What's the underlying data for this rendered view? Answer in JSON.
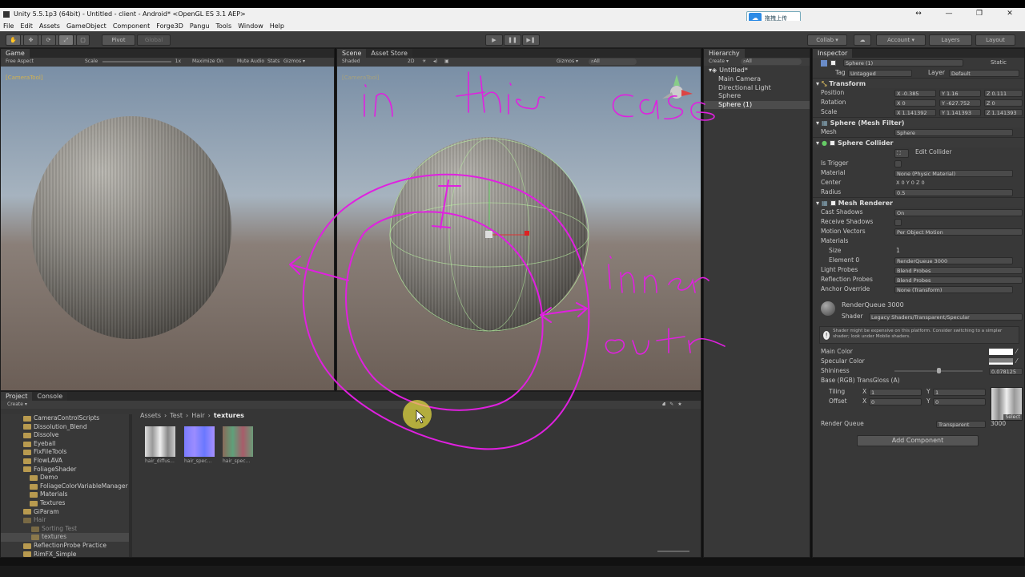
{
  "window": {
    "title": "Unity 5.5.1p3 (64bit) - Untitled - client - Android* <OpenGL ES 3.1 AEP>",
    "controls": [
      "↔",
      "—",
      "❐",
      "✕"
    ],
    "cloud_label": "拖拽上传"
  },
  "menu": [
    "File",
    "Edit",
    "Assets",
    "GameObject",
    "Component",
    "Forge3D",
    "Pangu",
    "Tools",
    "Window",
    "Help"
  ],
  "toolbar": {
    "pivot": "Pivot",
    "global": "Global",
    "collab": "Collab ▾",
    "account": "Account ▾",
    "layers": "Layers",
    "layout": "Layout"
  },
  "game": {
    "tab": "Game",
    "aspect": "Free Aspect",
    "scale_label": "Scale",
    "scale_value": "1x",
    "opts": [
      "Maximize On Play",
      "Mute Audio",
      "Stats",
      "Gizmos ▾"
    ],
    "overlay": "[CameraTool]"
  },
  "scene": {
    "tab": "Scene",
    "tab2": "Asset Store",
    "shaded": "Shaded",
    "mode2d": "2D",
    "gizmos": "Gizmos ▾",
    "search": "⌕All",
    "overlay": "[CameraTool]"
  },
  "hierarchy": {
    "tab": "Hierarchy",
    "create": "Create ▾",
    "search": "⌕All",
    "scene_name": "Untitled*",
    "items": [
      "Main Camera",
      "Directional Light",
      "Sphere",
      "Sphere (1)"
    ]
  },
  "project": {
    "tab": "Project",
    "tab2": "Console",
    "create": "Create ▾",
    "tree": [
      "CameraControlScripts",
      "Dissolution_Blend",
      "Dissolve",
      "Eyeball",
      "FixFileTools",
      "FlowLAVA",
      "FoliageShader",
      "Demo",
      "FoliageColorVariableManager",
      "Materials",
      "Textures",
      "GiParam",
      "Hair",
      "Sorting Test",
      "textures",
      "ReflectionProbe Practice",
      "RimFX_Simple"
    ],
    "breadcrumb": [
      "Assets",
      "Test",
      "Hair",
      "textures"
    ],
    "assets": [
      {
        "name": "hair_diffus...",
        "kind": "diffuse"
      },
      {
        "name": "hair_spec...",
        "kind": "normal"
      },
      {
        "name": "hair_spec...",
        "kind": "spec"
      }
    ]
  },
  "inspector": {
    "tab": "Inspector",
    "object_name": "Sphere (1)",
    "static": "Static",
    "tag_label": "Tag",
    "tag": "Untagged",
    "layer_label": "Layer",
    "layer": "Default",
    "transform": {
      "title": "Transform",
      "position": [
        "-0.385",
        "1.16",
        "0.111"
      ],
      "rotation": [
        "0",
        "-627.752",
        "0"
      ],
      "scale": [
        "1.141392",
        "1.141393",
        "1.141393"
      ],
      "labels": [
        "Position",
        "Rotation",
        "Scale"
      ]
    },
    "mesh_filter": {
      "title": "Sphere (Mesh Filter)",
      "mesh_label": "Mesh",
      "mesh": "Sphere"
    },
    "collider": {
      "title": "Sphere Collider",
      "edit": "Edit Collider",
      "rows": [
        {
          "label": "Is Trigger",
          "value": ""
        },
        {
          "label": "Material",
          "value": "None (Physic Material)"
        },
        {
          "label": "Center",
          "value": "X 0          Y 0          Z 0"
        },
        {
          "label": "Radius",
          "value": "0.5"
        }
      ]
    },
    "renderer": {
      "title": "Mesh Renderer",
      "rows": [
        {
          "label": "Cast Shadows",
          "value": "On"
        },
        {
          "label": "Receive Shadows",
          "value": ""
        },
        {
          "label": "Motion Vectors",
          "value": "Per Object Motion"
        },
        {
          "label": "Materials",
          "value": ""
        },
        {
          "label": "Size",
          "value": "1"
        },
        {
          "label": "Element 0",
          "value": "RenderQueue 3000"
        },
        {
          "label": "Light Probes",
          "value": "Blend Probes"
        },
        {
          "label": "Reflection Probes",
          "value": "Blend Probes"
        },
        {
          "label": "Anchor Override",
          "value": "None (Transform)"
        }
      ]
    },
    "material": {
      "name": "RenderQueue 3000",
      "shader_label": "Shader",
      "shader": "Legacy Shaders/Transparent/Specular",
      "warning": "Shader might be expensive on this platform. Consider switching to a simpler shader; look under Mobile shaders.",
      "main_color": "Main Color",
      "spec_color": "Specular Color",
      "shininess_label": "Shininess",
      "shininess": "0.078125",
      "shininess_level": 0.078125,
      "base": "Base (RGB) TransGloss (A)",
      "tiling_label": "Tiling",
      "offset_label": "Offset",
      "tiling": [
        "1",
        "1"
      ],
      "offset": [
        "0",
        "0"
      ],
      "select": "Select",
      "rq_label": "Render Queue",
      "rq_mode": "Transparent",
      "rq_value": "3000"
    },
    "add_component": "Add Component"
  },
  "annotations": {
    "color": "#e020e0",
    "texts": [
      "in",
      "this",
      "case",
      "inner",
      "outer"
    ]
  }
}
